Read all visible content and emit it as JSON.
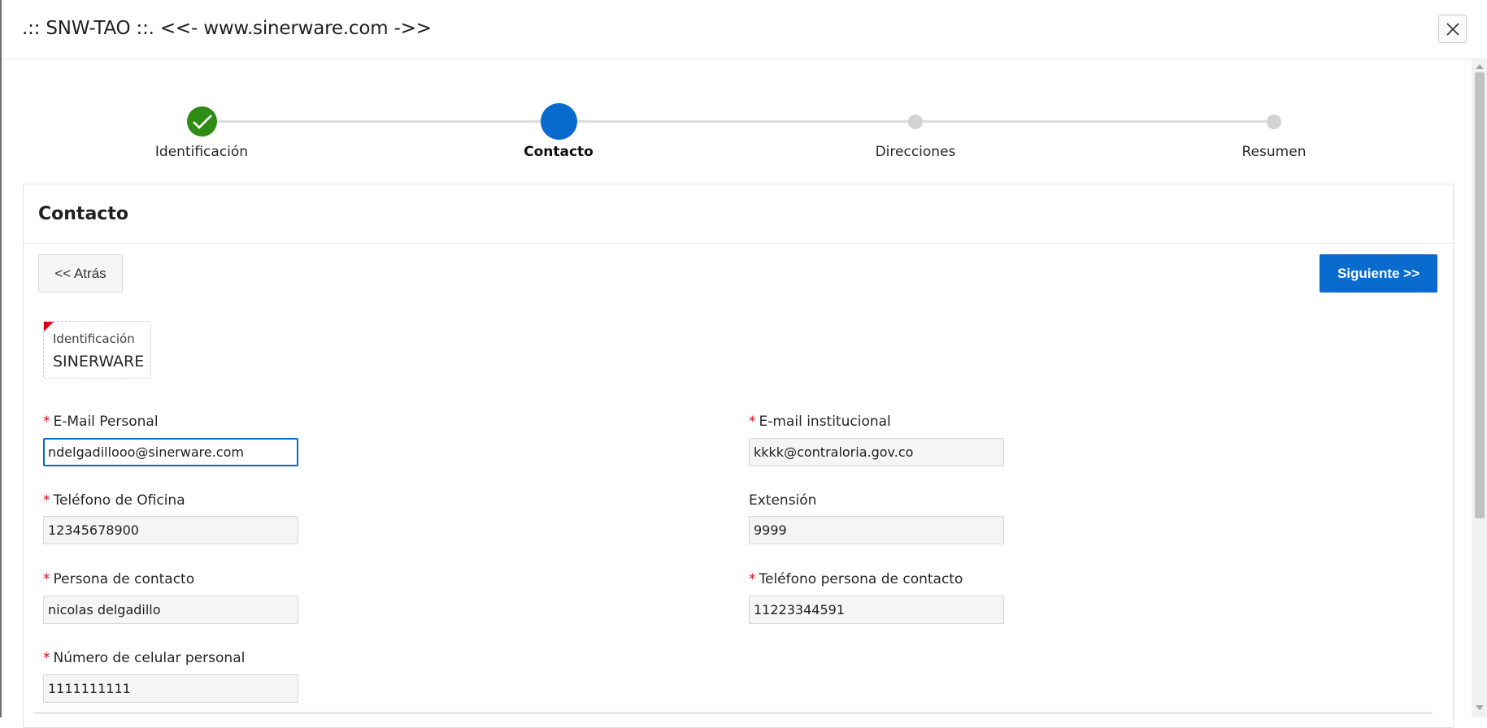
{
  "dialog": {
    "title": ".:: SNW-TAO ::. <<- www.sinerware.com ->>",
    "close_label": "Close"
  },
  "stepper": {
    "steps": [
      {
        "label": "Identificación",
        "state": "complete"
      },
      {
        "label": "Contacto",
        "state": "current"
      },
      {
        "label": "Direcciones",
        "state": "future"
      },
      {
        "label": "Resumen",
        "state": "future"
      }
    ]
  },
  "region": {
    "title": "Contacto",
    "back_label": "<< Atrás",
    "next_label": "Siguiente >>"
  },
  "identification": {
    "label": "Identificación",
    "value": "SINERWARE"
  },
  "fields": {
    "email_personal": {
      "label": "E-Mail Personal",
      "required": true,
      "value": "ndelgadillooo@sinerware.com"
    },
    "email_institucional": {
      "label": "E-mail institucional",
      "required": true,
      "value": "kkkk@contraloria.gov.co"
    },
    "telefono_oficina": {
      "label": "Teléfono de Oficina",
      "required": true,
      "value": "12345678900"
    },
    "extension": {
      "label": "Extensión",
      "required": false,
      "value": "9999"
    },
    "persona_contacto": {
      "label": "Persona de contacto",
      "required": true,
      "value": "nicolas delgadillo"
    },
    "telefono_persona_contacto": {
      "label": "Teléfono persona de contacto",
      "required": true,
      "value": "11223344591"
    },
    "celular_personal": {
      "label": "Número de celular personal",
      "required": true,
      "value": "1111111111"
    }
  },
  "required_mark": "*",
  "colors": {
    "primary": "#0a6bcf",
    "complete": "#2e8b13",
    "required": "#d9001b"
  }
}
